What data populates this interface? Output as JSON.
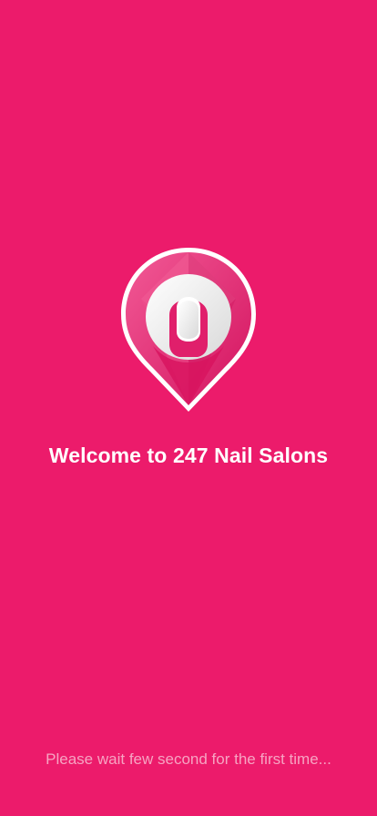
{
  "colors": {
    "background": "#EC1B6B",
    "title_text": "#FFFFFF",
    "note_text": "#F6A4C2",
    "logo_outline": "#FFFFFF",
    "logo_pink_light": "#F0528F",
    "logo_pink_dark": "#C9115A"
  },
  "logo": {
    "icon": "nail-location-pin-icon"
  },
  "splash": {
    "title": "Welcome to 247 Nail Salons",
    "note": "Please wait few second for the first time..."
  }
}
